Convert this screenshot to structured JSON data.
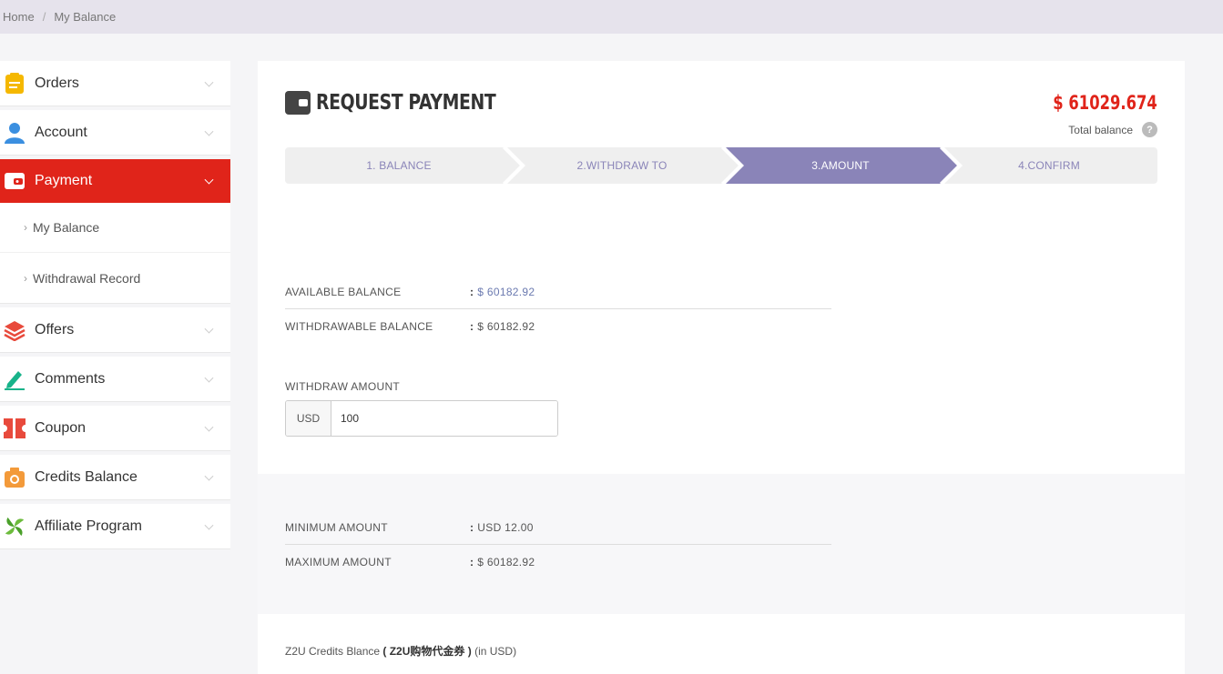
{
  "breadcrumb": {
    "home": "Home",
    "separator": "/",
    "current": "My Balance"
  },
  "sidebar": {
    "items": [
      {
        "label": "Orders",
        "icon": "clipboard-icon"
      },
      {
        "label": "Account",
        "icon": "user-icon"
      },
      {
        "label": "Payment",
        "icon": "wallet-icon",
        "active": true
      },
      {
        "label": "Offers",
        "icon": "layers-icon"
      },
      {
        "label": "Comments",
        "icon": "pen-icon"
      },
      {
        "label": "Coupon",
        "icon": "ticket-icon"
      },
      {
        "label": "Credits Balance",
        "icon": "camera-icon"
      },
      {
        "label": "Affiliate Program",
        "icon": "leaf-icon"
      }
    ],
    "payment_sub": [
      {
        "label": "My Balance"
      },
      {
        "label": "Withdrawal Record"
      }
    ]
  },
  "header": {
    "title": "REQUEST PAYMENT",
    "total_amount": "$ 61029.674",
    "total_label": "Total balance",
    "help": "?"
  },
  "steps": [
    {
      "label": "1. BALANCE",
      "active": false
    },
    {
      "label": "2.WITHDRAW TO",
      "active": false
    },
    {
      "label": "3.AMOUNT",
      "active": true
    },
    {
      "label": "4.CONFIRM",
      "active": false
    }
  ],
  "balances": {
    "available_label": "AVAILABLE BALANCE",
    "available_value": "$ 60182.92",
    "withdrawable_label": "WITHDRAWABLE BALANCE",
    "withdrawable_value": "$ 60182.92"
  },
  "withdraw": {
    "label": "WITHDRAW AMOUNT",
    "currency": "USD",
    "value": "100"
  },
  "limits": {
    "minimum_label": "MINIMUM AMOUNT",
    "minimum_value": "USD 12.00",
    "maximum_label": "MAXIMUM AMOUNT",
    "maximum_value": "$ 60182.92"
  },
  "credits": {
    "prefix": "Z2U Credits Blance",
    "bold": "( Z2U购物代金券 )",
    "suffix": "(in USD)"
  },
  "colors": {
    "accent_red": "#e0241a",
    "step_active": "#8a84b8",
    "step_inactive": "#efefef"
  },
  "colon": ":"
}
